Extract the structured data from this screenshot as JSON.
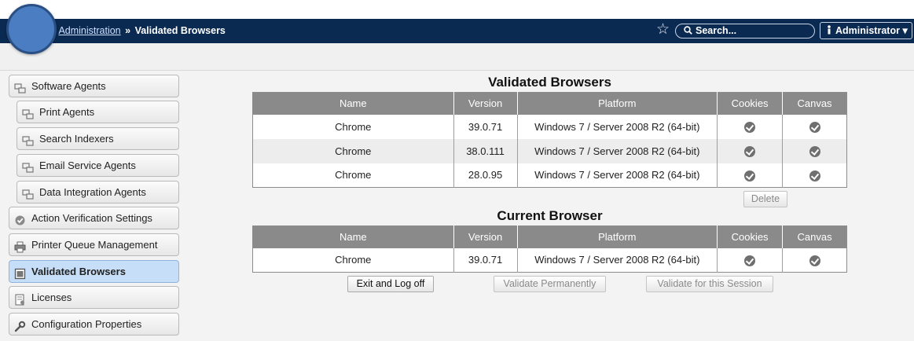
{
  "header": {
    "breadcrumb_sep_lead": "»",
    "breadcrumb_link": "Administration",
    "breadcrumb_sep": "»",
    "breadcrumb_current": "Validated Browsers",
    "search_placeholder": "Search...",
    "user_label": "Administrator",
    "user_caret": "▾"
  },
  "sidebar": {
    "items": [
      {
        "label": "Software Agents",
        "icon": "agent-icon"
      },
      {
        "label": "Print Agents",
        "icon": "agent-icon"
      },
      {
        "label": "Search Indexers",
        "icon": "agent-icon"
      },
      {
        "label": "Email Service Agents",
        "icon": "agent-icon"
      },
      {
        "label": "Data Integration Agents",
        "icon": "agent-icon"
      },
      {
        "label": "Action Verification Settings",
        "icon": "verify-check-icon"
      },
      {
        "label": "Printer Queue Management",
        "icon": "printer-icon"
      },
      {
        "label": "Validated Browsers",
        "icon": "browser-icon",
        "active": true
      },
      {
        "label": "Licenses",
        "icon": "license-icon"
      },
      {
        "label": "Configuration Properties",
        "icon": "wrench-icon"
      }
    ]
  },
  "validated": {
    "title": "Validated Browsers",
    "columns": [
      "Name",
      "Version",
      "Platform",
      "Cookies",
      "Canvas"
    ],
    "rows": [
      {
        "name": "Chrome",
        "version": "39.0.71",
        "platform": "Windows 7 / Server 2008 R2 (64-bit)",
        "cookies": true,
        "canvas": true
      },
      {
        "name": "Chrome",
        "version": "38.0.111",
        "platform": "Windows 7 / Server 2008 R2 (64-bit)",
        "cookies": true,
        "canvas": true
      },
      {
        "name": "Chrome",
        "version": "28.0.95",
        "platform": "Windows 7 / Server 2008 R2 (64-bit)",
        "cookies": true,
        "canvas": true
      }
    ],
    "delete_label": "Delete"
  },
  "current": {
    "title": "Current Browser",
    "columns": [
      "Name",
      "Version",
      "Platform",
      "Cookies",
      "Canvas"
    ],
    "rows": [
      {
        "name": "Chrome",
        "version": "39.0.71",
        "platform": "Windows 7 / Server 2008 R2 (64-bit)",
        "cookies": true,
        "canvas": true
      }
    ]
  },
  "actions": {
    "exit_label": "Exit and Log off",
    "validate_perm_label": "Validate Permanently",
    "validate_session_label": "Validate for this Session"
  },
  "colors": {
    "header_bg": "#0b2a52",
    "active_item_bg": "#c6def7",
    "table_header_bg": "#8a8a8a"
  }
}
